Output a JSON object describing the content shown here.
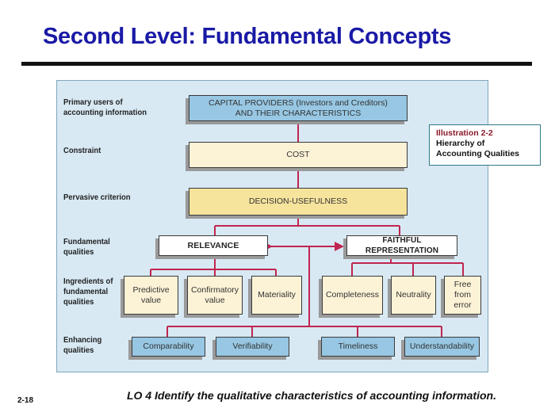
{
  "slide": {
    "title": "Second Level: Fundamental Concepts",
    "page_number": "2-18",
    "learning_objective": "LO 4  Identify the qualitative characteristics of accounting information."
  },
  "illustration": {
    "number": "Illustration 2-2",
    "caption_line1": "Hierarchy of",
    "caption_line2": "Accounting Qualities"
  },
  "row_labels": {
    "primary_users": [
      "Primary users of",
      "accounting information"
    ],
    "constraint": [
      "Constraint"
    ],
    "pervasive": [
      "Pervasive criterion"
    ],
    "fundamental": [
      "Fundamental",
      "qualities"
    ],
    "ingredients": [
      "Ingredients of",
      "fundamental",
      "qualities"
    ],
    "enhancing": [
      "Enhancing",
      "qualities"
    ]
  },
  "boxes": {
    "capital_providers": [
      "CAPITAL PROVIDERS (Investors and Creditors)",
      "AND THEIR CHARACTERISTICS"
    ],
    "cost": "COST",
    "decision_usefulness": "DECISION-USEFULNESS",
    "relevance": "RELEVANCE",
    "faithful_representation": "FAITHFUL REPRESENTATION",
    "relevance_ingredients": [
      [
        "Predictive",
        "value"
      ],
      [
        "Confirmatory",
        "value"
      ],
      [
        "Materiality"
      ]
    ],
    "faithful_ingredients": [
      [
        "Completeness"
      ],
      [
        "Neutrality"
      ],
      [
        "Free",
        "from",
        "error"
      ]
    ],
    "enhancing": [
      "Comparability",
      "Verifiability",
      "Timeliness",
      "Understandability"
    ]
  },
  "colors": {
    "title": "#1a1aa6",
    "panel_bg": "#d8e9f4",
    "connector": "#c0254f",
    "blue_box": "#97c7e3",
    "cream_box": "#fcf2d6",
    "yellow_box": "#f6e39c",
    "illustration_number": "#8b1a2b"
  }
}
